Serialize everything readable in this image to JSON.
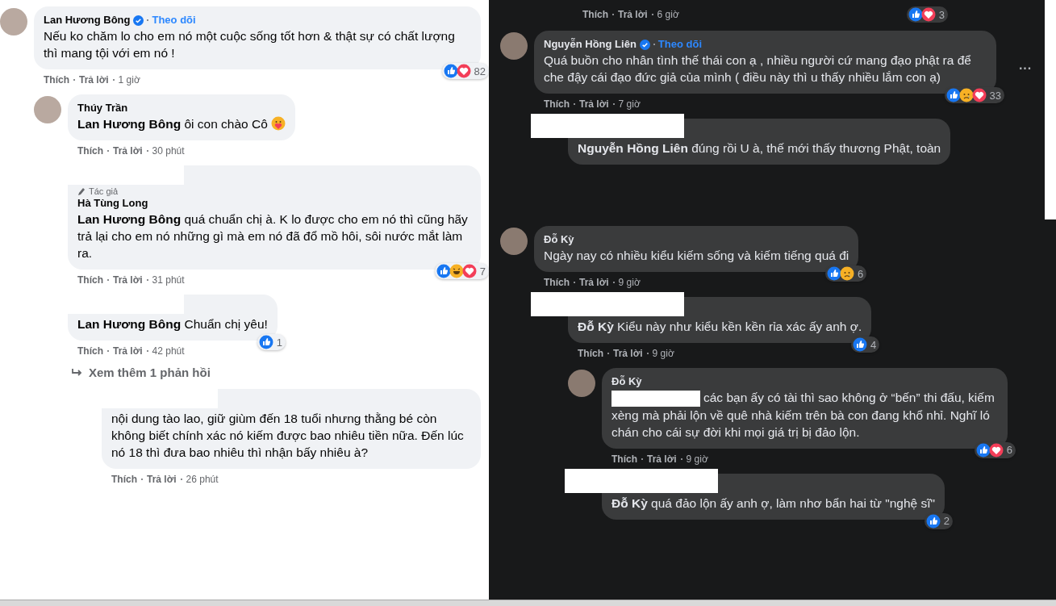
{
  "panels": [
    {
      "kind": "light",
      "comments": [
        {
          "author": "Lan Hương Bông",
          "verified": true,
          "follow": "Theo dõi",
          "text": "Nếu ko chăm lo cho em nó một cuộc sống tốt hơn & thật sự có chất lượng thì mang tội với em nó !",
          "reactions": {
            "icons": [
              {
                "kind": "like"
              },
              {
                "kind": "love"
              }
            ],
            "count": "82"
          },
          "like": "Thích",
          "reply": "Trả lời",
          "time": "1 giờ",
          "children": [
            {
              "author": "Thúy Trần",
              "text": "**Lan Hương Bông** ôi con chào Cô",
              "emoji": true,
              "like": "Thích",
              "reply": "Trả lời",
              "time": "30 phút"
            },
            {
              "author_tag": "Tác giả",
              "author": "Hà Tùng Long",
              "redacted": true,
              "text": "**Lan Hương Bông** quá chuẩn chị à. K lo được cho em nó thì cũng hãy trả lại cho em nó những gì mà em nó đã đổ mồ hôi, sôi nước mắt làm ra.",
              "reactions": {
                "icons": [
                  {
                    "kind": "like"
                  },
                  {
                    "kind": "haha"
                  },
                  {
                    "kind": "love"
                  }
                ],
                "count": "7"
              },
              "like": "Thích",
              "reply": "Trả lời",
              "time": "31 phút"
            },
            {
              "redacted": true,
              "text": "**Lan Hương Bông** Chuẩn chị yêu!",
              "reactions": {
                "icons": [
                  {
                    "kind": "like"
                  }
                ],
                "count": "1"
              },
              "like": "Thích",
              "reply": "Trả lời",
              "time": "42 phút",
              "more_replies": "Xem thêm 1 phản hồi",
              "children": [
                {
                  "redacted": true,
                  "text": "nội dung tào lao, giữ giùm đến 18 tuổi nhưng thằng bé còn không biết chính xác nó kiếm được bao nhiêu tiền nữa. Đến lúc nó 18 thì đưa bao nhiêu thì nhận bấy nhiêu à?",
                  "like": "Thích",
                  "reply": "Trả lời",
                  "time": "26 phút"
                }
              ]
            }
          ]
        }
      ]
    },
    {
      "kind": "dark",
      "cut_comment": {
        "like": "Thích",
        "reply": "Trả lời",
        "time": "6 giờ",
        "reactions": {
          "icons": [
            {
              "kind": "like"
            },
            {
              "kind": "love"
            }
          ],
          "count": "3"
        }
      },
      "comments": [
        {
          "author": "Nguyễn Hồng Liên",
          "verified": true,
          "follow": "Theo dõi",
          "more_menu": "···",
          "text": "Quá buồn cho nhân tình thế thái con ạ , nhiều người cứ mang đạo phật ra để che đậy cái đạo đức giả của mình ( điều này thì u thấy nhiều lắm con ạ)",
          "reactions": {
            "icons": [
              {
                "kind": "like"
              },
              {
                "kind": "sad"
              },
              {
                "kind": "love"
              }
            ],
            "count": "33"
          },
          "like": "Thích",
          "reply": "Trả lời",
          "time": "7 giờ",
          "children": [
            {
              "redacted": true,
              "text": "**Nguyễn Hồng Liên** đúng rồi U à, thế mới thấy thương Phật, toàn"
            }
          ]
        }
      ]
    },
    {
      "kind": "dark",
      "comments": [
        {
          "author": "Đỗ Kỳ",
          "text": "Ngày nay có nhiều kiểu kiếm sống và kiếm tiếng quá đi",
          "reactions": {
            "icons": [
              {
                "kind": "like"
              },
              {
                "kind": "sad"
              }
            ],
            "count": "6"
          },
          "like": "Thích",
          "reply": "Trả lời",
          "time": "9 giờ",
          "children": [
            {
              "redacted": true,
              "text": "**Đỗ Kỳ** Kiểu này như kiểu kền kền rỉa xác ấy anh ợ.",
              "reactions": {
                "icons": [
                  {
                    "kind": "like"
                  }
                ],
                "count": "4"
              },
              "like": "Thích",
              "reply": "Trả lời",
              "time": "9 giờ",
              "children": [
                {
                  "author": "Đỗ Kỳ",
                  "text_redacted": true,
                  "text": "các bạn ấy có tài thì sao không ở “bến” thi đấu, kiếm xèng mà phải lộn về quê nhà kiếm trên bà con đang khổ nhỉ. Nghĩ ló chán cho cái sự đời khi mọi giá trị bị đảo lộn.",
                  "reactions": {
                    "icons": [
                      {
                        "kind": "like"
                      },
                      {
                        "kind": "love"
                      }
                    ],
                    "count": "6"
                  },
                  "like": "Thích",
                  "reply": "Trả lời",
                  "time": "9 giờ"
                },
                {
                  "redacted": true,
                  "text": "**Đỗ Kỳ** quá đảo lộn ấy anh ợ, làm nhơ bẩn hai từ \"nghệ sĩ\"",
                  "reactions": {
                    "icons": [
                      {
                        "kind": "like"
                      }
                    ],
                    "count": "2"
                  }
                }
              ]
            }
          ]
        }
      ]
    }
  ]
}
